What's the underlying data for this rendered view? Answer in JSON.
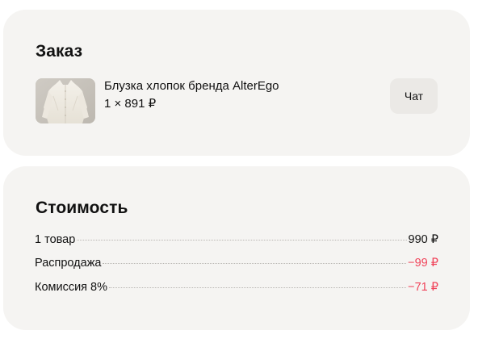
{
  "order": {
    "title": "Заказ",
    "product": {
      "name": "Блузка хлопок бренда AlterEgo",
      "quantity_price": "1 × 891 ₽",
      "image_icon": "blouse-photo"
    },
    "chat_label": "Чат"
  },
  "cost": {
    "title": "Стоимость",
    "rows": [
      {
        "label": "1 товар",
        "value": "990 ₽",
        "tone": "normal"
      },
      {
        "label": "Распродажа",
        "value": "−99 ₽",
        "tone": "discount"
      },
      {
        "label": "Комиссия 8%",
        "value": "−71 ₽",
        "tone": "discount"
      }
    ]
  },
  "colors": {
    "card_background": "#f5f4f2",
    "chat_button_background": "#ebe9e6",
    "discount": "#f0435a",
    "text": "#111111"
  }
}
